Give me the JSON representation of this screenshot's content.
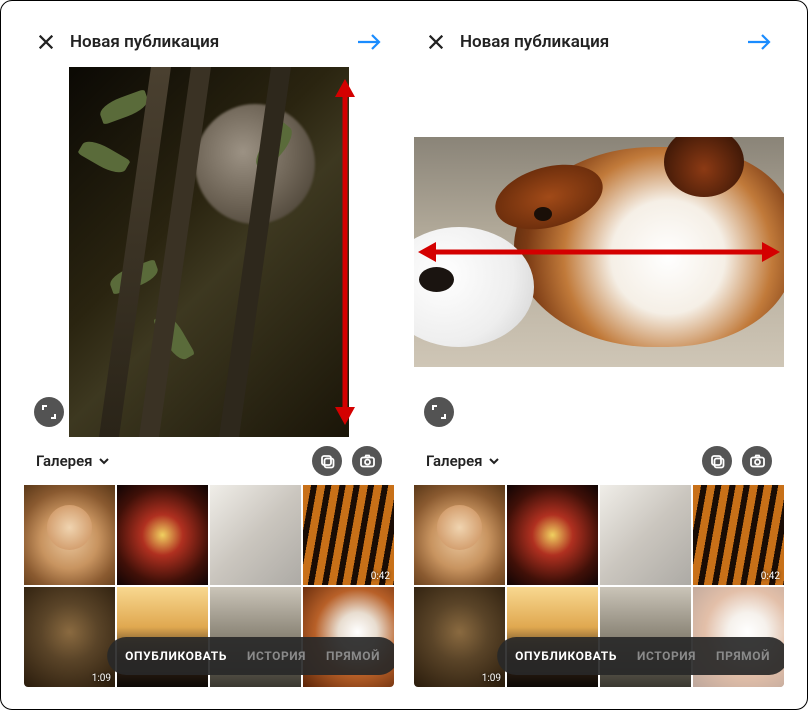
{
  "header": {
    "title": "Новая публикация"
  },
  "source": {
    "label": "Галерея"
  },
  "tabs": {
    "publish": "ОПУБЛИКОВАТЬ",
    "story": "ИСТОРИЯ",
    "live": "ПРЯМОЙ"
  },
  "thumbs": {
    "tiger_duration": "0:42",
    "owl_duration": "1:09"
  }
}
